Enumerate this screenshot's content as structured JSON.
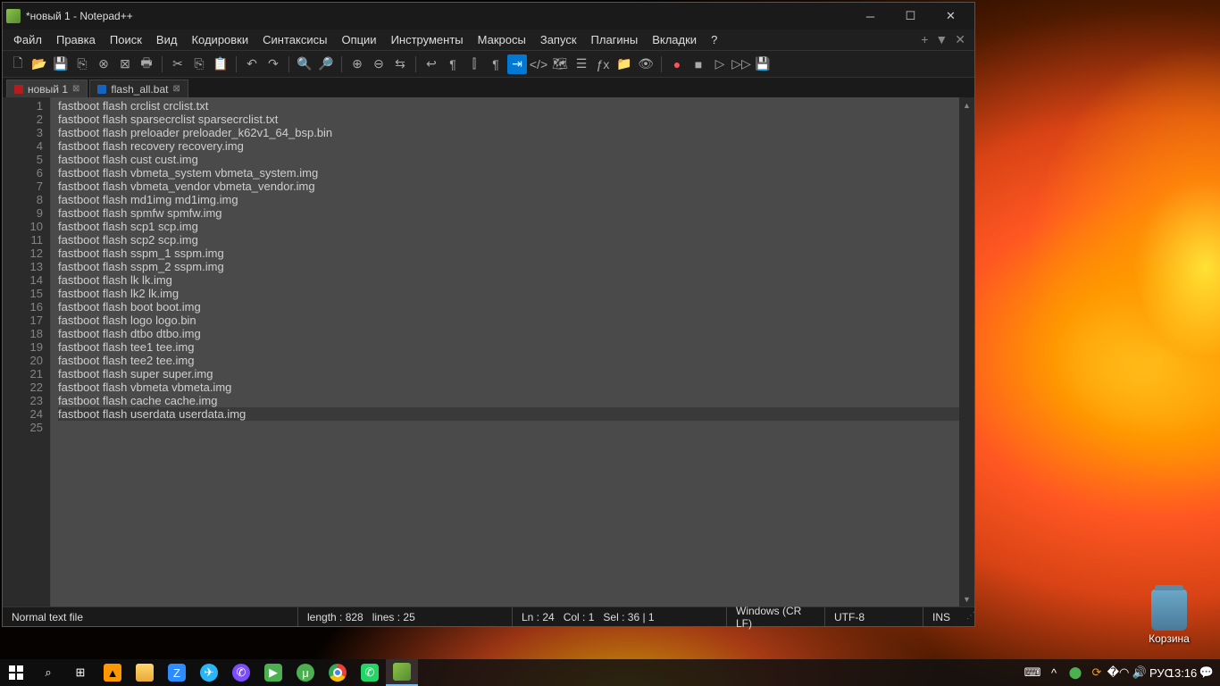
{
  "window": {
    "title": "*новый 1 - Notepad++"
  },
  "menubar": {
    "items": [
      "Файл",
      "Правка",
      "Поиск",
      "Вид",
      "Кодировки",
      "Синтаксисы",
      "Опции",
      "Инструменты",
      "Макросы",
      "Запуск",
      "Плагины",
      "Вкладки",
      "?"
    ]
  },
  "tabs": [
    {
      "label": "новый 1",
      "modified": true,
      "active": true
    },
    {
      "label": "flash_all.bat",
      "modified": false,
      "active": false
    }
  ],
  "code_lines": [
    "fastboot flash crclist crclist.txt",
    "fastboot flash sparsecrclist sparsecrclist.txt",
    "fastboot flash preloader preloader_k62v1_64_bsp.bin",
    "fastboot flash recovery recovery.img",
    "fastboot flash cust cust.img",
    "fastboot flash vbmeta_system vbmeta_system.img",
    "fastboot flash vbmeta_vendor vbmeta_vendor.img",
    "fastboot flash md1img md1img.img",
    "fastboot flash spmfw spmfw.img",
    "fastboot flash scp1 scp.img",
    "fastboot flash scp2 scp.img",
    "fastboot flash sspm_1 sspm.img",
    "fastboot flash sspm_2 sspm.img",
    "fastboot flash lk lk.img",
    "fastboot flash lk2 lk.img",
    "fastboot flash boot boot.img",
    "fastboot flash logo logo.bin",
    "fastboot flash dtbo dtbo.img",
    "fastboot flash tee1 tee.img",
    "fastboot flash tee2 tee.img",
    "fastboot flash super super.img",
    "fastboot flash vbmeta vbmeta.img",
    "fastboot flash cache cache.img",
    "fastboot flash userdata userdata.img",
    ""
  ],
  "current_line_index": 23,
  "status": {
    "filetype": "Normal text file",
    "length_label": "length : 828",
    "lines_label": "lines : 25",
    "ln": "Ln : 24",
    "col": "Col : 1",
    "sel": "Sel : 36 | 1",
    "eol": "Windows (CR LF)",
    "encoding": "UTF-8",
    "mode": "INS"
  },
  "desktop": {
    "trash_label": "Корзина"
  },
  "taskbar": {
    "lang": "РУС",
    "time": "13:16"
  }
}
